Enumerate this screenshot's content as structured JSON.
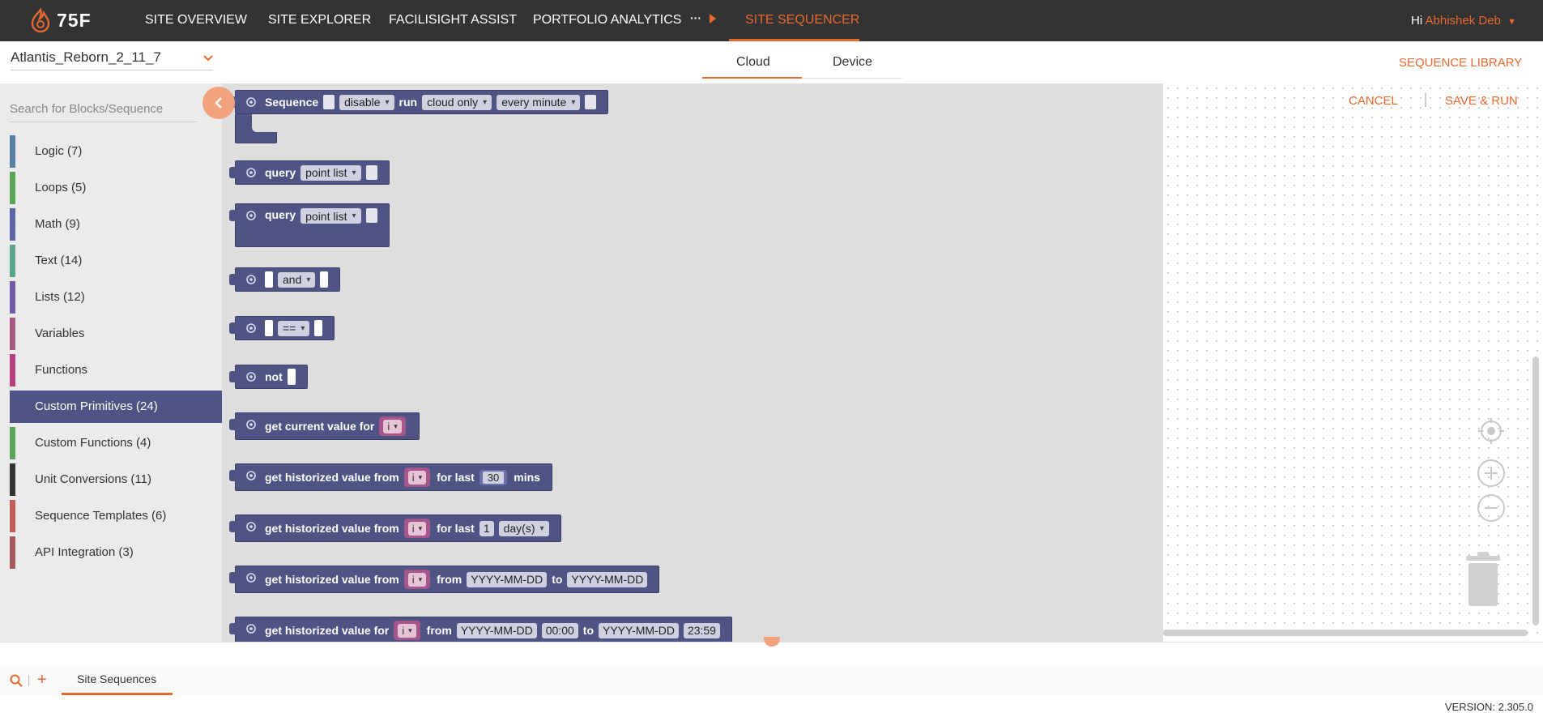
{
  "brand": {
    "logo_text": "75F",
    "accent": "#e8692e",
    "nav_bg": "#333333",
    "block_color": "#4f5485"
  },
  "nav": {
    "items": [
      "SITE OVERVIEW",
      "SITE EXPLORER",
      "FACILISIGHT ASSIST",
      "PORTFOLIO ANALYTICS"
    ],
    "more": "···",
    "active": "SITE SEQUENCER",
    "greeting": "Hi",
    "user": "Abhishek Deb"
  },
  "header": {
    "site": "Atlantis_Reborn_2_11_7",
    "tabs": [
      "Cloud",
      "Device"
    ],
    "active_tab": "Cloud",
    "library": "SEQUENCE LIBRARY"
  },
  "sidebar": {
    "search_placeholder": "Search for Blocks/Sequence",
    "categories": [
      {
        "label": "Logic (7)",
        "color": "#5b80a5"
      },
      {
        "label": "Loops (5)",
        "color": "#5ba55b"
      },
      {
        "label": "Math (9)",
        "color": "#5b67a5"
      },
      {
        "label": "Text (14)",
        "color": "#5ba58c"
      },
      {
        "label": "Lists (12)",
        "color": "#745ba5"
      },
      {
        "label": "Variables",
        "color": "#a55b80"
      },
      {
        "label": "Functions",
        "color": "#995ba5"
      },
      {
        "label": "Custom Primitives (24)",
        "color": "#4f5485",
        "selected": true
      },
      {
        "label": "Custom Functions (4)",
        "color": "#5ba55b"
      },
      {
        "label": "Unit Conversions (11)",
        "color": "#333333"
      },
      {
        "label": "Sequence Templates (6)",
        "color": "#c45c5c"
      },
      {
        "label": "API Integration (3)",
        "color": "#a55b5b"
      }
    ]
  },
  "blocks": {
    "sequence": {
      "label": "Sequence",
      "state": "disable",
      "run": "run",
      "target": "cloud only",
      "schedule": "every minute"
    },
    "query1": {
      "label": "query",
      "option": "point list"
    },
    "query2": {
      "label": "query",
      "option": "point list"
    },
    "and_block": {
      "op": "and"
    },
    "eq_block": {
      "op": "=="
    },
    "not_block": {
      "label": "not"
    },
    "current": {
      "label": "get current value for",
      "var": "i"
    },
    "hist_mins": {
      "label": "get historized value from",
      "var": "i",
      "for_last": "for last",
      "value": "30",
      "unit": "mins"
    },
    "hist_days": {
      "label": "get historized value from",
      "var": "i",
      "for_last": "for last",
      "value": "1",
      "unit": "day(s)"
    },
    "hist_range": {
      "label": "get historized value from",
      "var": "i",
      "from": "from",
      "start": "YYYY-MM-DD",
      "to": "to",
      "end": "YYYY-MM-DD"
    },
    "hist_range_time": {
      "label": "get historized value for",
      "var": "i",
      "from": "from",
      "start": "YYYY-MM-DD",
      "start_time": "00:00",
      "to": "to",
      "end": "YYYY-MM-DD",
      "end_time": "23:59"
    }
  },
  "workspace": {
    "cancel": "CANCEL",
    "save": "SAVE & RUN"
  },
  "bottom": {
    "tab": "Site Sequences",
    "version": "VERSION: 2.305.0"
  }
}
